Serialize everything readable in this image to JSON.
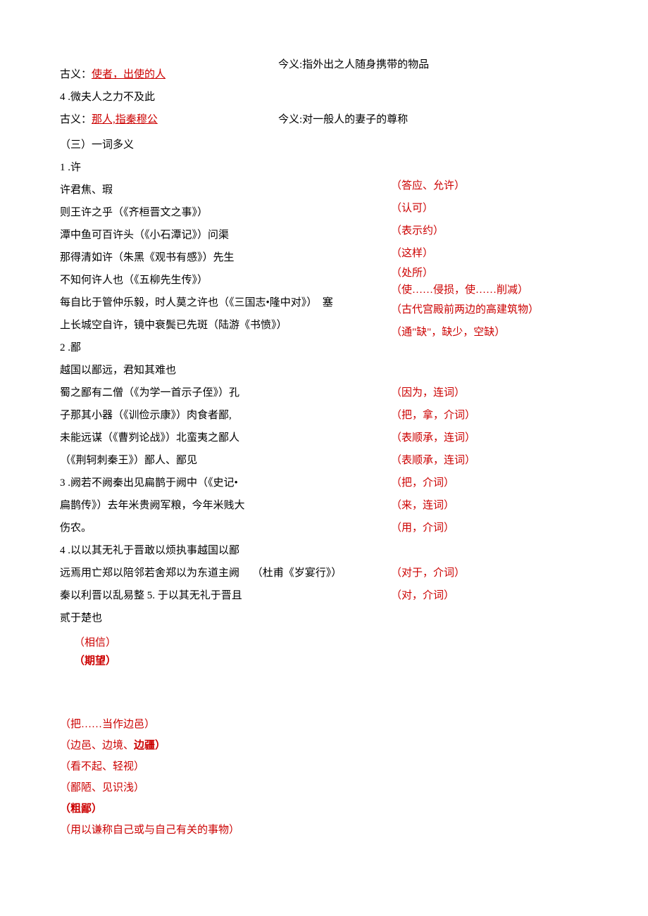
{
  "top": {
    "l1_left_a": "古义：",
    "l1_left_b": "使者，出使的人",
    "l1_right": "今义:指外出之人随身携带的物品",
    "l2": "4 .微夫人之力不及此",
    "l3_left_a": "古义：",
    "l3_left_b": "那人,指秦穆公",
    "l3_right": "今义:对一般人的妻子的尊称",
    "l4": "（三）一词多义",
    "l5": "1 .许"
  },
  "xu": {
    "left": [
      "许君焦、瑕",
      "则王许之乎（《齐桓晋文之事》）",
      "潭中鱼可百许头（《小石潭记》）问渠",
      "那得清如许（朱黑《观书有感》）先生",
      "不知何许人也（《五柳先生传》）",
      "每自比于管仲乐毅，时人莫之许也（《三国志•隆中对》）　塞",
      "上长城空自许，镜中衰鬓已先斑（陆游《书愤》）"
    ],
    "right": [
      "（答应、允许）",
      "（认可）",
      "（表示约）",
      "（这样）",
      "（处所）",
      "（使……侵损，使……削减）",
      "（古代宫殿前两边的高建筑物）",
      "（通\"缺\"，缺少，空缺）"
    ]
  },
  "bi": {
    "head": "2 .鄙",
    "l1": "越国以鄙远，君知其难也",
    "left": [
      "蜀之鄙有二僧（《为学一首示子侄》）孔",
      "子那其小器（《训俭示康》）肉食者鄙,",
      "未能远谋（《曹刿论战》）北蛮夷之鄙人",
      "（《荆轲刺秦王》）鄙人、鄙见",
      "3 .阙若不阙秦出见扁鹊于阙中（《史记•",
      "扁鹊传》）去年米贵阙军粮，今年米贱大",
      "伤农。",
      "4 .以以其无礼于晋敢以烦执事越国以鄙",
      "远焉用亡郑以陪邻若舍郑以为东道主阙",
      "秦以利晋以乱易整 5. 于以其无礼于晋且",
      "贰于楚也"
    ],
    "mid": "（杜甫《岁宴行》）",
    "right": [
      "（因为，连词）",
      "（把，拿，介词）",
      "（表顺承，连词）",
      "（表顺承，连词）",
      "（把，介词）",
      "（来，连词）",
      "（用，介词）",
      "",
      "（对于，介词）",
      "（对，介词）"
    ]
  },
  "lower": [
    {
      "txt": "（相信）",
      "cls": "red indent"
    },
    {
      "txt": "（期望）",
      "cls": "red bold indent"
    },
    {
      "txt": "",
      "cls": ""
    },
    {
      "txt": "",
      "cls": ""
    },
    {
      "txt": "（把……当作边邑）",
      "cls": "red"
    },
    {
      "txt_a": "（边邑、边境、",
      "txt_b": "边疆）",
      "cls": "red",
      "mix": true
    },
    {
      "txt": "（看不起、轻视）",
      "cls": "red"
    },
    {
      "txt": "（鄙陋、见识浅）",
      "cls": "red"
    },
    {
      "txt": "（粗鄙）",
      "cls": "red bold"
    },
    {
      "txt": "（用以谦称自己或与自己有关的事物）",
      "cls": "red"
    }
  ]
}
